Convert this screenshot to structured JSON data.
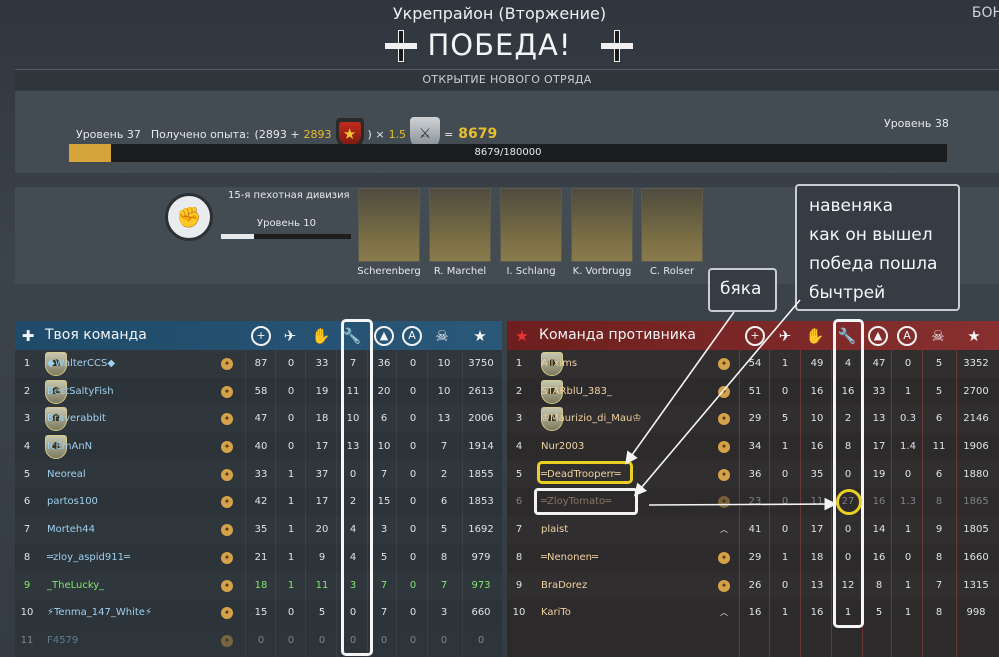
{
  "header": {
    "mode_title": "Укрепрайон (Вторжение)",
    "result": "ПОБЕДА!",
    "right_tab": "БОН",
    "banner": "ОТКРЫТИЕ НОВОГО ОТРЯДА"
  },
  "experience": {
    "level_current": "Уровень 37",
    "gained_label": "Получено опыта:",
    "open_paren": "(2893 +",
    "bonus": "2893",
    "close_mult": ") ×",
    "multiplier": "1.5",
    "equals": "=",
    "total": "8679",
    "level_next": "Уровень 38",
    "progress_text": "8679/180000",
    "progress_fraction": 0.048
  },
  "division": {
    "name": "15-я пехотная дивизия",
    "level": "Уровень 10",
    "progress_fraction": 0.25,
    "officers": [
      "Scherenberg",
      "R. Marchel",
      "I. Schlang",
      "K. Vorbrugg",
      "C. Rolser"
    ]
  },
  "annotations": {
    "note_main": [
      "навеняка",
      "как он вышел",
      "победа пошла",
      "бычтрей"
    ],
    "note_small": "бяка"
  },
  "team_left": {
    "title": "Твоя команда",
    "rows": [
      {
        "n": "1",
        "name": "◆WalterCCS◆",
        "v": [
          "87",
          "0",
          "33",
          "7",
          "36",
          "0",
          "10",
          "3750"
        ]
      },
      {
        "n": "2",
        "name": "BestSaltyFish",
        "v": [
          "58",
          "0",
          "19",
          "11",
          "20",
          "0",
          "10",
          "2613"
        ]
      },
      {
        "n": "3",
        "name": "Braverabbit",
        "v": [
          "47",
          "0",
          "18",
          "10",
          "6",
          "0",
          "13",
          "2006"
        ]
      },
      {
        "n": "4",
        "name": "IcEmAnN",
        "v": [
          "40",
          "0",
          "17",
          "13",
          "10",
          "0",
          "7",
          "1914"
        ]
      },
      {
        "n": "5",
        "name": "Neoreal",
        "v": [
          "33",
          "1",
          "37",
          "0",
          "7",
          "0",
          "2",
          "1855"
        ]
      },
      {
        "n": "6",
        "name": "partos100",
        "v": [
          "42",
          "1",
          "17",
          "2",
          "15",
          "0",
          "6",
          "1853"
        ]
      },
      {
        "n": "7",
        "name": "Morteh44",
        "v": [
          "35",
          "1",
          "20",
          "4",
          "3",
          "0",
          "5",
          "1692"
        ]
      },
      {
        "n": "8",
        "name": "═zloy_aspid911═",
        "v": [
          "21",
          "1",
          "9",
          "4",
          "5",
          "0",
          "8",
          "979"
        ]
      },
      {
        "n": "9",
        "name": "_TheLucky_",
        "v": [
          "18",
          "1",
          "11",
          "3",
          "7",
          "0",
          "7",
          "973"
        ]
      },
      {
        "n": "10",
        "name": "⚡Tenma_147_White⚡",
        "v": [
          "15",
          "0",
          "5",
          "0",
          "7",
          "0",
          "3",
          "660"
        ]
      },
      {
        "n": "11",
        "name": "F4579",
        "v": [
          "0",
          "0",
          "0",
          "0",
          "0",
          "0",
          "0",
          "0"
        ]
      }
    ]
  },
  "team_right": {
    "title": "Команда противника",
    "rows": [
      {
        "n": "1",
        "name": "Allxims",
        "v": [
          "54",
          "1",
          "49",
          "4",
          "47",
          "0",
          "5",
          "3352"
        ]
      },
      {
        "n": "2",
        "name": "STARblU_383_",
        "v": [
          "51",
          "0",
          "16",
          "16",
          "33",
          "1",
          "5",
          "2700"
        ]
      },
      {
        "n": "3",
        "name": "♔Maurizio_di_Mau♔",
        "v": [
          "29",
          "5",
          "10",
          "2",
          "13",
          "0.3",
          "6",
          "2146"
        ]
      },
      {
        "n": "4",
        "name": "Nur2003",
        "v": [
          "34",
          "1",
          "16",
          "8",
          "17",
          "1.4",
          "11",
          "1906"
        ]
      },
      {
        "n": "5",
        "name": "═DeadTrooperr═",
        "v": [
          "36",
          "0",
          "35",
          "0",
          "19",
          "0",
          "6",
          "1880"
        ]
      },
      {
        "n": "6",
        "name": "═ZloyTomato═",
        "v": [
          "23",
          "0",
          "11",
          "27",
          "16",
          "1.3",
          "8",
          "1865"
        ]
      },
      {
        "n": "7",
        "name": "plaist",
        "v": [
          "41",
          "0",
          "17",
          "0",
          "14",
          "1",
          "9",
          "1805"
        ]
      },
      {
        "n": "8",
        "name": "═Nenonen═",
        "v": [
          "29",
          "1",
          "18",
          "0",
          "16",
          "0",
          "8",
          "1660"
        ]
      },
      {
        "n": "9",
        "name": "BraDorez",
        "v": [
          "26",
          "0",
          "13",
          "12",
          "8",
          "1",
          "7",
          "1315"
        ]
      },
      {
        "n": "10",
        "name": "KariTo",
        "v": [
          "16",
          "1",
          "16",
          "1",
          "5",
          "1",
          "8",
          "998"
        ]
      }
    ]
  },
  "colors": {
    "accent_gold": "#e8bf2c",
    "left_header": "#2a5878",
    "right_header": "#883030",
    "highlight_yellow": "#e9cf22"
  }
}
